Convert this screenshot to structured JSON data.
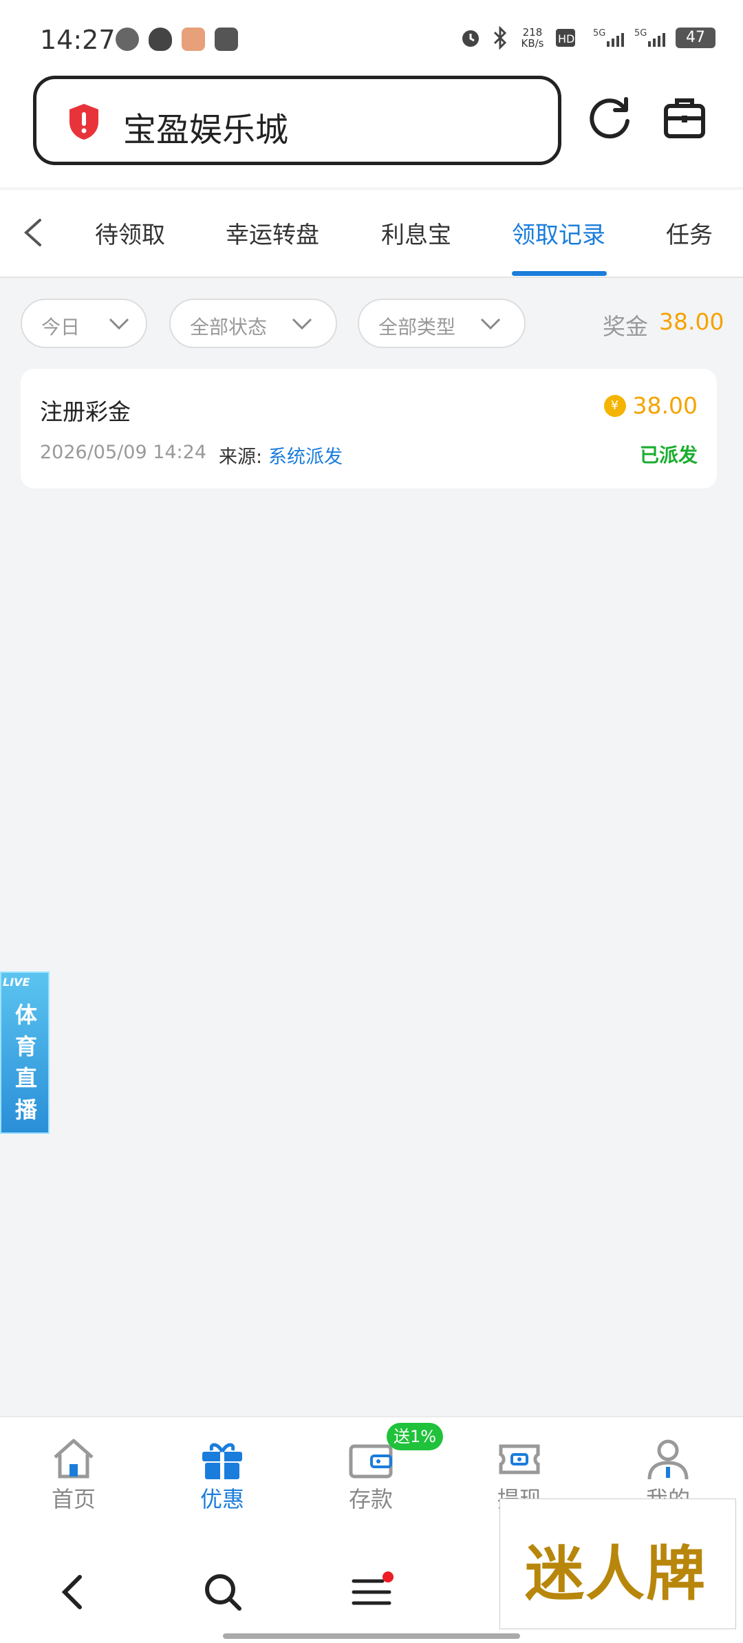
{
  "status_bar": {
    "time": "14:27",
    "speed": "218 KB/s",
    "battery": "47"
  },
  "header": {
    "title": "宝盈娱乐城"
  },
  "tabs": [
    {
      "label": "待领取"
    },
    {
      "label": "幸运转盘"
    },
    {
      "label": "利息宝"
    },
    {
      "label": "领取记录"
    },
    {
      "label": "任务"
    }
  ],
  "filters": {
    "date": "今日",
    "status": "全部状态",
    "type": "全部类型",
    "bonus_label": "奖金",
    "bonus_value": "38.00"
  },
  "records": [
    {
      "title": "注册彩金",
      "amount": "38.00",
      "datetime": "2026/05/09 14:24",
      "source_label": "来源:",
      "source": "系统派发",
      "status": "已派发"
    }
  ],
  "live_badge": {
    "tag": "LIVE",
    "text": "体育直播"
  },
  "bottom_nav": {
    "items": [
      {
        "label": "首页"
      },
      {
        "label": "优惠"
      },
      {
        "label": "存款"
      },
      {
        "label": "提现"
      },
      {
        "label": "我的"
      }
    ],
    "deposit_badge": "送1%"
  },
  "watermark": "迷人牌",
  "colors": {
    "accent": "#1a7ddb",
    "bonus": "#f4a300",
    "success": "#1aad2f"
  }
}
